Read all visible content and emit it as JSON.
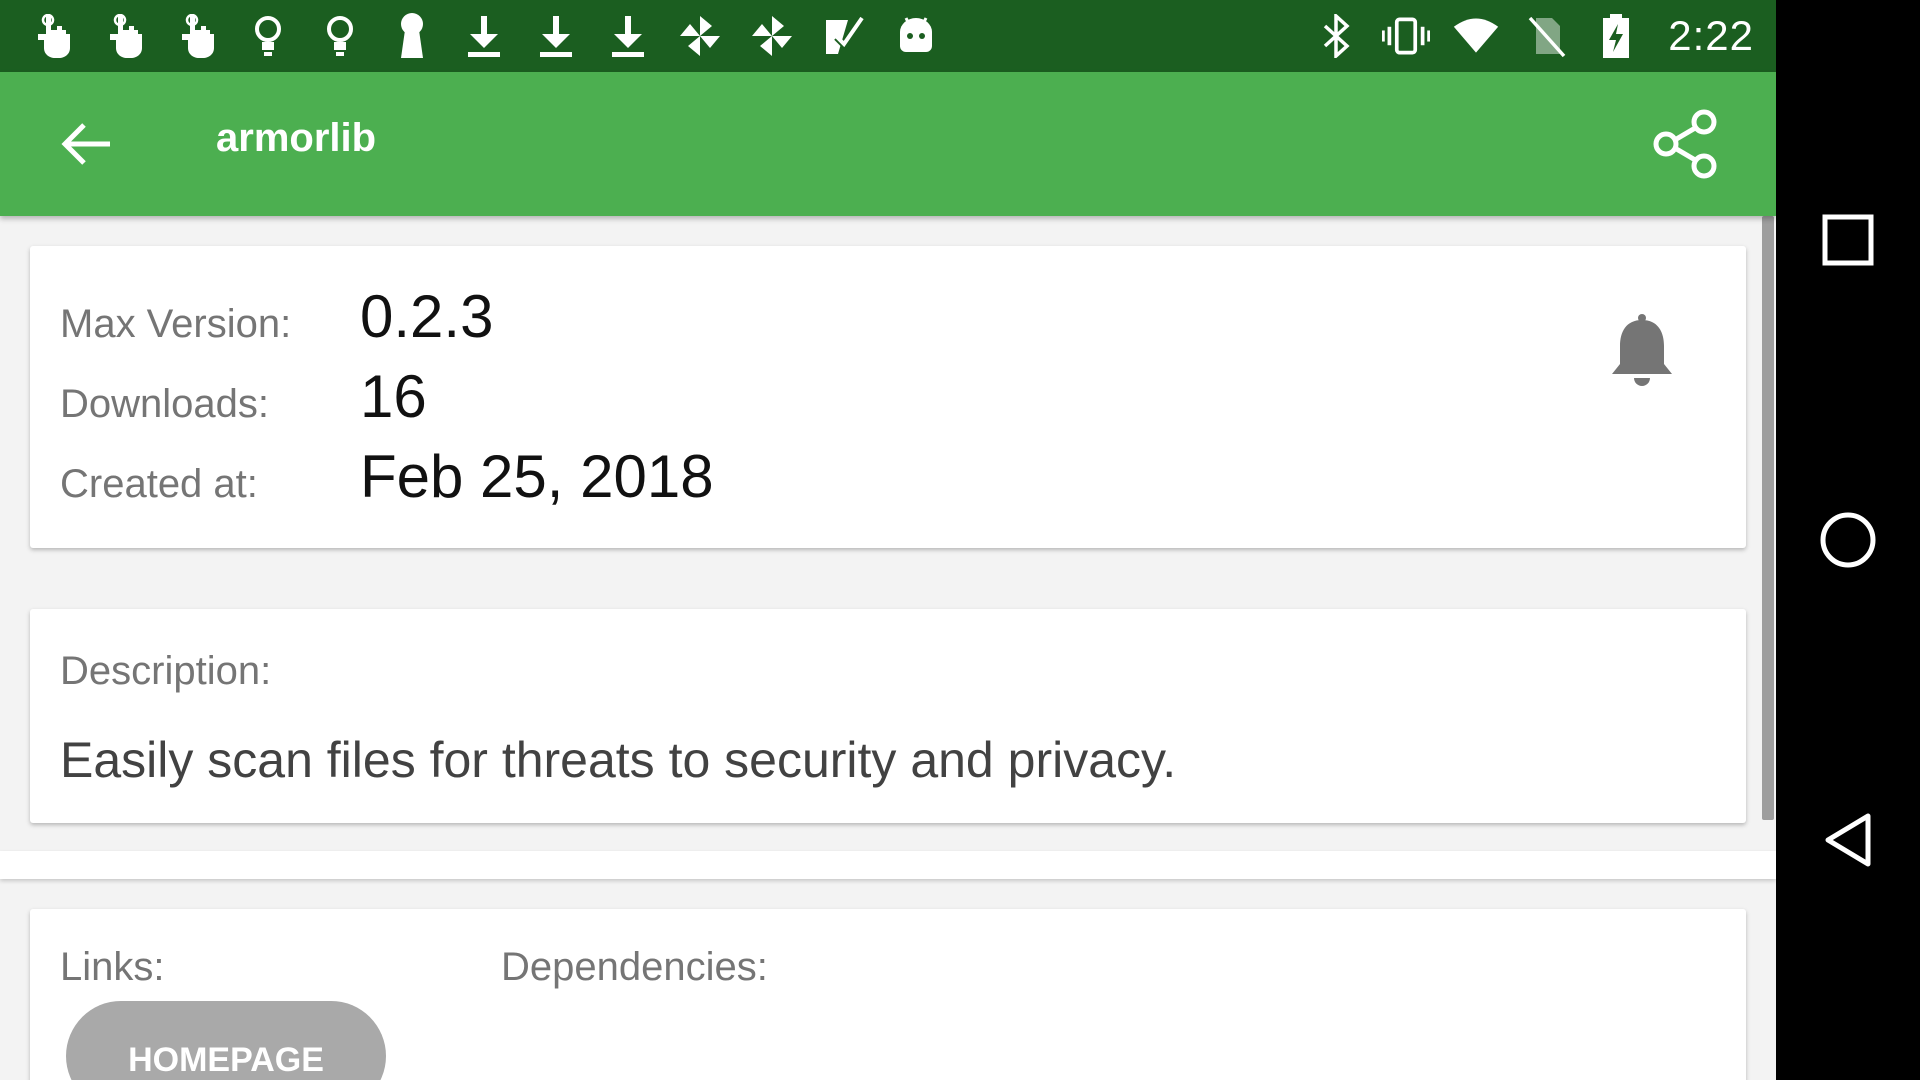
{
  "status_bar": {
    "time": "2:22",
    "left_icons": [
      "hand-icon",
      "hand-icon",
      "hand-icon",
      "bulb-icon",
      "bulb-icon",
      "keyhole-icon",
      "download-icon",
      "download-icon",
      "download-icon",
      "pinwheel-icon",
      "pinwheel-icon",
      "checklist-icon",
      "android-icon"
    ],
    "right_icons": [
      "bluetooth-icon",
      "vibrate-icon",
      "wifi-icon",
      "no-sim-icon",
      "battery-charging-icon"
    ]
  },
  "app_bar": {
    "title": "armorlib",
    "color": "#4caf50"
  },
  "info_card": {
    "max_version_label": "Max Version:",
    "max_version_value": "0.2.3",
    "downloads_label": "Downloads:",
    "downloads_value": "16",
    "created_label": "Created at:",
    "created_value": "Feb 25, 2018"
  },
  "description_card": {
    "label": "Description:",
    "text": "Easily scan files for threats to security and privacy."
  },
  "links_card": {
    "links_label": "Links:",
    "dependencies_label": "Dependencies:",
    "homepage_button": "HOMEPAGE"
  },
  "colors": {
    "status_bar": "#1b5e20",
    "app_bar": "#4caf50",
    "button": "#a9a9a9"
  }
}
